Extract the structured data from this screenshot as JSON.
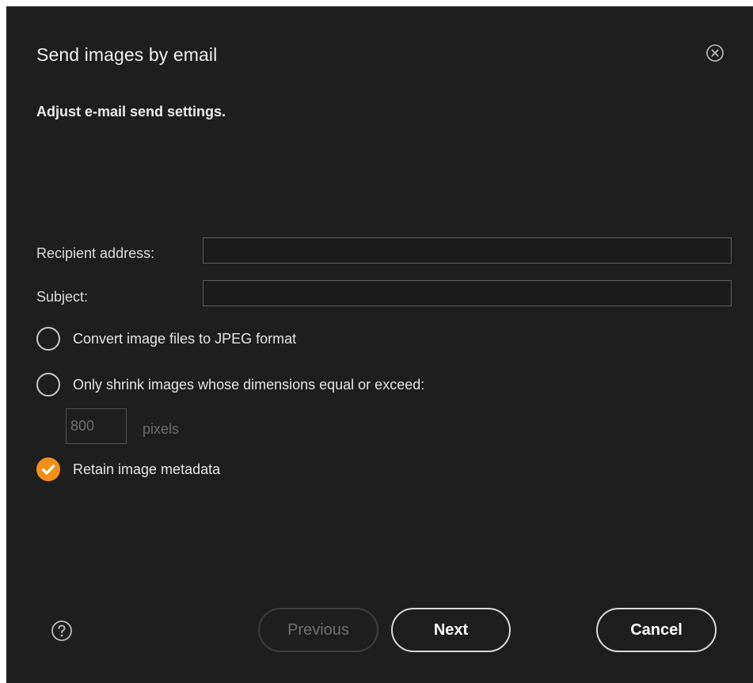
{
  "dialog": {
    "title": "Send images by email",
    "subtitle": "Adjust e-mail send settings."
  },
  "icons": {
    "close": "close-circle-icon",
    "help": "help-circle-icon",
    "check": "checkmark-icon"
  },
  "colors": {
    "background": "#1e1e1f",
    "accent": "#f28f17",
    "text": "#e6e6e6",
    "disabled_text": "#6f6f72"
  },
  "form": {
    "recipient_label": "Recipient address:",
    "recipient_value": "",
    "subject_label": "Subject:",
    "subject_value": ""
  },
  "options": {
    "convert_jpeg": {
      "label": "Convert image files to JPEG format",
      "checked": false
    },
    "shrink_images": {
      "label": "Only shrink images whose dimensions equal or exceed:",
      "checked": false
    },
    "retain_metadata": {
      "label": "Retain image metadata",
      "checked": true
    }
  },
  "shrink": {
    "value": "800",
    "unit": "pixels"
  },
  "buttons": {
    "previous": "Previous",
    "next": "Next",
    "cancel": "Cancel"
  }
}
